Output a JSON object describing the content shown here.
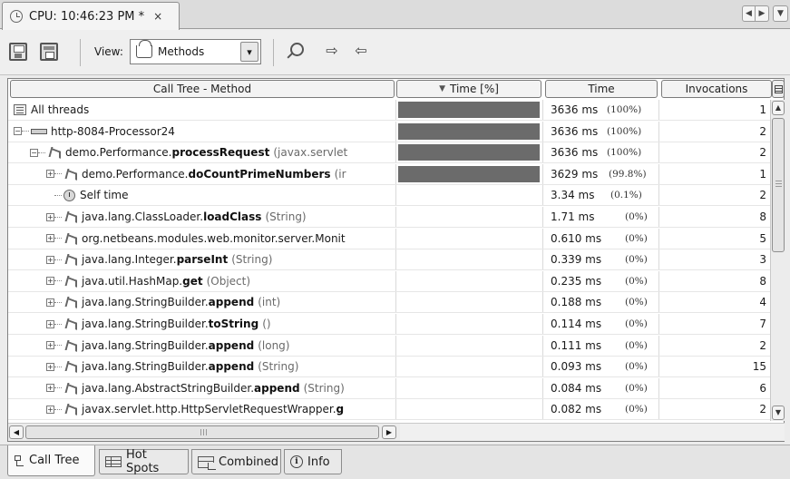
{
  "doc_tab": {
    "title": "CPU: 10:46:23 PM *",
    "close": "×"
  },
  "toolbar": {
    "view_label": "View:",
    "view_value": "Methods"
  },
  "columns": {
    "method": "Call Tree - Method",
    "time_pct": "Time [%]",
    "time": "Time",
    "invocations": "Invocations"
  },
  "rows": [
    {
      "depth": 0,
      "icon": "all-threads-icon",
      "expander": "",
      "prefix": "All threads",
      "name": "",
      "args": "",
      "bar": 1.0,
      "time": "3636 ms",
      "pct": "(100%)",
      "inv": "1"
    },
    {
      "depth": 1,
      "icon": "thread-icon",
      "expander": "−",
      "prefix": "http-8084-Processor24",
      "name": "",
      "args": "",
      "bar": 1.0,
      "time": "3636 ms",
      "pct": "(100%)",
      "inv": "2"
    },
    {
      "depth": 2,
      "icon": "method-icon",
      "expander": "−",
      "prefix": "demo.Performance.",
      "name": "processRequest",
      "args": "(javax.servlet",
      "bar": 1.0,
      "time": "3636 ms",
      "pct": "(100%)",
      "inv": "2"
    },
    {
      "depth": 3,
      "icon": "method-icon",
      "expander": "+",
      "prefix": "demo.Performance.",
      "name": "doCountPrimeNumbers",
      "args": "(ir",
      "bar": 0.998,
      "time": "3629 ms",
      "pct": "(99.8%)",
      "inv": "1"
    },
    {
      "depth": 3,
      "icon": "self-time-icon",
      "expander": "",
      "prefix": "Self time",
      "name": "",
      "args": "",
      "bar": 0.001,
      "time": "3.34 ms",
      "pct": "(0.1%)",
      "inv": "2"
    },
    {
      "depth": 3,
      "icon": "method-icon",
      "expander": "+",
      "prefix": "java.lang.ClassLoader.",
      "name": "loadClass",
      "args": "(String)",
      "bar": 0,
      "time": "1.71 ms",
      "pct": "(0%)",
      "inv": "8"
    },
    {
      "depth": 3,
      "icon": "method-icon",
      "expander": "+",
      "prefix": "org.netbeans.modules.web.monitor.server.Monit",
      "name": "",
      "args": "",
      "bar": 0,
      "time": "0.610 ms",
      "pct": "(0%)",
      "inv": "5"
    },
    {
      "depth": 3,
      "icon": "method-icon",
      "expander": "+",
      "prefix": "java.lang.Integer.",
      "name": "parseInt",
      "args": "(String)",
      "bar": 0,
      "time": "0.339 ms",
      "pct": "(0%)",
      "inv": "3"
    },
    {
      "depth": 3,
      "icon": "method-icon",
      "expander": "+",
      "prefix": "java.util.HashMap.",
      "name": "get",
      "args": "(Object)",
      "bar": 0,
      "time": "0.235 ms",
      "pct": "(0%)",
      "inv": "8"
    },
    {
      "depth": 3,
      "icon": "method-icon",
      "expander": "+",
      "prefix": "java.lang.StringBuilder.",
      "name": "append",
      "args": "(int)",
      "bar": 0,
      "time": "0.188 ms",
      "pct": "(0%)",
      "inv": "4"
    },
    {
      "depth": 3,
      "icon": "method-icon",
      "expander": "+",
      "prefix": "java.lang.StringBuilder.",
      "name": "toString",
      "args": "()",
      "bar": 0,
      "time": "0.114 ms",
      "pct": "(0%)",
      "inv": "7"
    },
    {
      "depth": 3,
      "icon": "method-icon",
      "expander": "+",
      "prefix": "java.lang.StringBuilder.",
      "name": "append",
      "args": "(long)",
      "bar": 0,
      "time": "0.111 ms",
      "pct": "(0%)",
      "inv": "2"
    },
    {
      "depth": 3,
      "icon": "method-icon",
      "expander": "+",
      "prefix": "java.lang.StringBuilder.",
      "name": "append",
      "args": "(String)",
      "bar": 0,
      "time": "0.093 ms",
      "pct": "(0%)",
      "inv": "15"
    },
    {
      "depth": 3,
      "icon": "method-icon",
      "expander": "+",
      "prefix": "java.lang.AbstractStringBuilder.",
      "name": "append",
      "args": "(String)",
      "bar": 0,
      "time": "0.084 ms",
      "pct": "(0%)",
      "inv": "6"
    },
    {
      "depth": 3,
      "icon": "method-icon",
      "expander": "+",
      "prefix": "javax.servlet.http.HttpServletRequestWrapper.",
      "name": "g",
      "args": "",
      "bar": 0,
      "time": "0.082 ms",
      "pct": "(0%)",
      "inv": "2"
    }
  ],
  "bottom_tabs": [
    {
      "label": "Call Tree",
      "icon": "call-tree-icon"
    },
    {
      "label": "Hot Spots",
      "icon": "hot-spots-icon"
    },
    {
      "label": "Combined",
      "icon": "combined-icon"
    },
    {
      "label": "Info",
      "icon": "info-icon"
    }
  ],
  "colors": {
    "bar_fill": "#6b6b6b"
  }
}
